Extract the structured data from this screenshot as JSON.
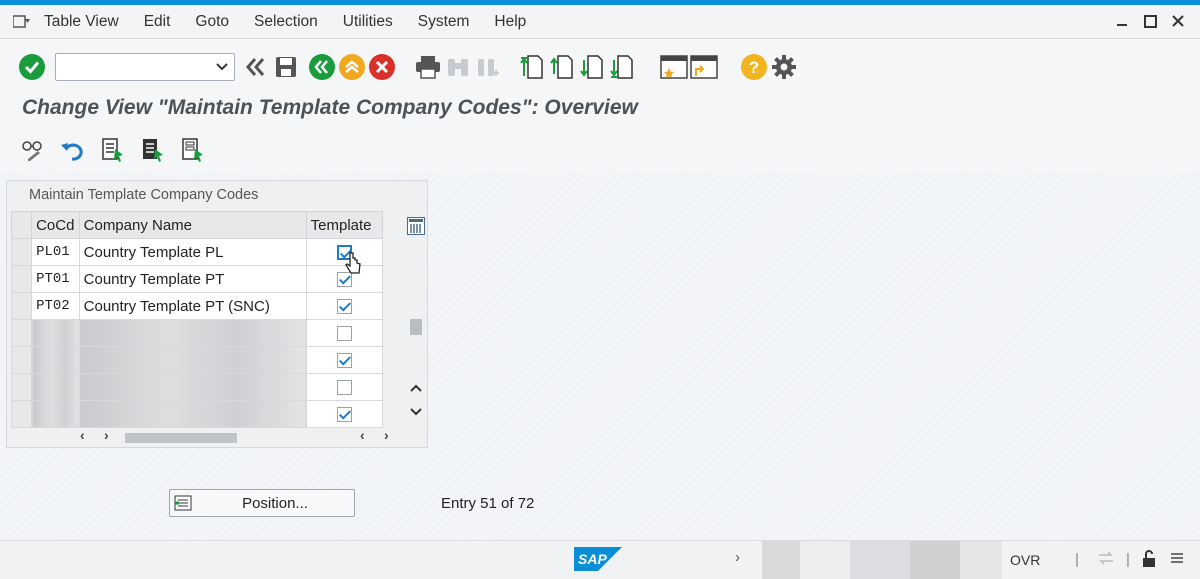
{
  "menubar": {
    "items": [
      "Table View",
      "Edit",
      "Goto",
      "Selection",
      "Utilities",
      "System",
      "Help"
    ]
  },
  "toolbar": {
    "command_value": "",
    "icons": [
      "enter-icon",
      "back-double-icon",
      "save-icon",
      "back-icon",
      "exit-icon",
      "cancel-icon",
      "print-icon",
      "find-icon",
      "find-next-icon",
      "first-page-icon",
      "previous-page-icon",
      "next-page-icon",
      "last-page-icon",
      "create-session-icon",
      "shortcut-icon",
      "help-icon",
      "settings-icon"
    ]
  },
  "page": {
    "title": "Change View \"Maintain Template Company Codes\": Overview"
  },
  "table": {
    "title": "Maintain Template Company Codes",
    "headers": {
      "code": "CoCd",
      "name": "Company Name",
      "template": "Template"
    },
    "rows": [
      {
        "code": "PL01",
        "name": "Country Template PL",
        "template": true,
        "blurred": false
      },
      {
        "code": "PT01",
        "name": "Country Template PT",
        "template": true,
        "blurred": false
      },
      {
        "code": "PT02",
        "name": "Country Template PT (SNC)",
        "template": true,
        "blurred": false
      },
      {
        "code": "",
        "name": "",
        "template": false,
        "blurred": true
      },
      {
        "code": "",
        "name": "",
        "template": true,
        "blurred": true
      },
      {
        "code": "",
        "name": "",
        "template": false,
        "blurred": true
      },
      {
        "code": "",
        "name": "",
        "template": true,
        "blurred": true
      }
    ]
  },
  "footer": {
    "position_label": "Position...",
    "entry_text": "Entry 51 of 72"
  },
  "statusbar": {
    "brand": "SAP",
    "mode": "OVR"
  },
  "colors": {
    "accent": "#0a8fd6",
    "enter_green": "#1a9b3c",
    "exit_orange": "#f0a81c",
    "cancel_red": "#d9312a",
    "help_yellow": "#f2b51f"
  }
}
